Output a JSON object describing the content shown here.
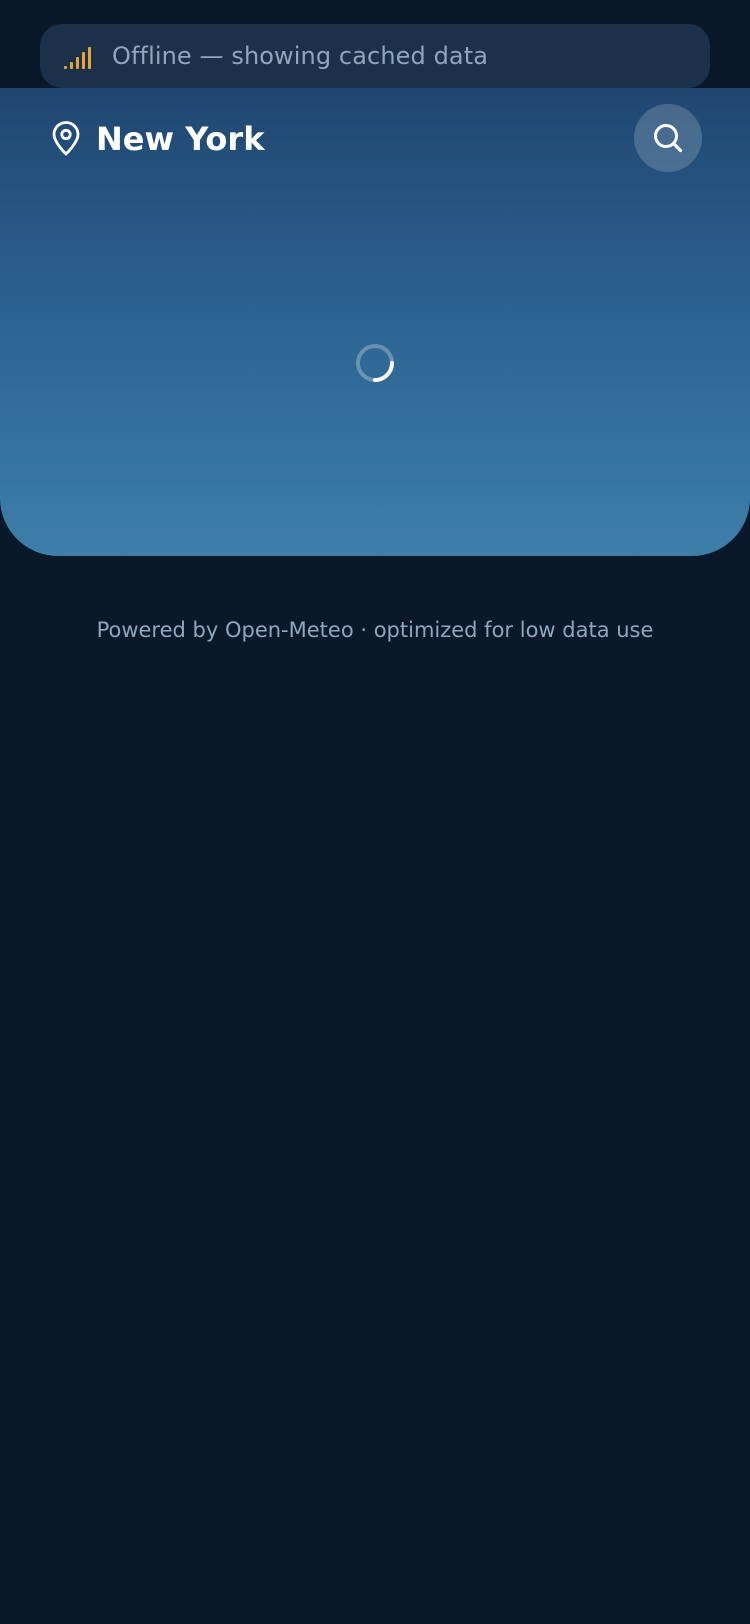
{
  "banner": {
    "icon": "signal-weak-icon",
    "text": "Offline — showing cached data",
    "icon_color": "#e8a33d"
  },
  "header": {
    "location_icon": "map-pin-icon",
    "city": "New York",
    "search_icon": "search-icon"
  },
  "main": {
    "loading_icon": "loading-spinner-icon"
  },
  "footer": {
    "credit": "Powered by Open-Meteo · optimized for low data use"
  },
  "colors": {
    "background": "#0a1929",
    "hero_top": "#1d3b64",
    "hero_bottom": "#3d7fa9",
    "banner_bg": "#1b3149",
    "muted_text": "#8fa6bd"
  }
}
